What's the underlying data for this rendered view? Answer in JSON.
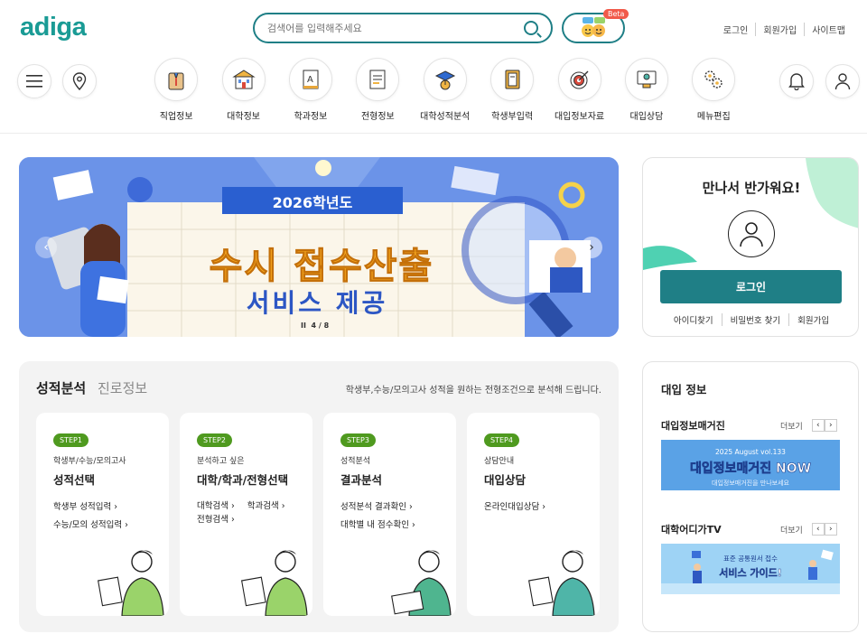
{
  "header": {
    "logo": "adiga",
    "search_placeholder": "검색어를 입력해주세요",
    "beta": "Beta",
    "links": [
      "로그인",
      "회원가입",
      "사이트맵"
    ]
  },
  "nav": [
    {
      "label": "직업정보",
      "icon": "job-icon"
    },
    {
      "label": "대학정보",
      "icon": "university-icon"
    },
    {
      "label": "학과정보",
      "icon": "book-icon"
    },
    {
      "label": "전형정보",
      "icon": "document-icon"
    },
    {
      "label": "대학성적분석",
      "icon": "graduation-chart-icon"
    },
    {
      "label": "학생부입력",
      "icon": "notebook-icon"
    },
    {
      "label": "대입정보자료",
      "icon": "target-icon"
    },
    {
      "label": "대입상담",
      "icon": "monitor-counsel-icon"
    },
    {
      "label": "메뉴편집",
      "icon": "gears-icon"
    }
  ],
  "banner": {
    "year": "2026학년도",
    "headline": "수시 접수산출",
    "sub": "서비스 제공",
    "pager": "4 / 8",
    "pause": "II"
  },
  "login": {
    "greeting": "만나서 반가워요!",
    "button": "로그인",
    "links": [
      "아이디찾기",
      "비밀번호 찾기",
      "회원가입"
    ]
  },
  "grade": {
    "tab_active": "성적분석",
    "tab_inactive": "진로정보",
    "desc": "학생부,수능/모의고사 성적을 원하는 전형조건으로 분석해 드립니다.",
    "cards": [
      {
        "step": "STEP1",
        "sub": "학생부/수능/모의고사",
        "title": "성적선택",
        "links": [
          "학생부 성적입력 ›",
          "수능/모의 성적입력 ›"
        ]
      },
      {
        "step": "STEP2",
        "sub": "분석하고 싶은",
        "title": "대학/학과/전형선택",
        "links": [
          "대학검색 ›",
          "학과검색 ›",
          "전형검색 ›"
        ]
      },
      {
        "step": "STEP3",
        "sub": "성적분석",
        "title": "결과분석",
        "links": [
          "성적분석 결과확인 ›",
          "대학별 내 점수확인 ›"
        ]
      },
      {
        "step": "STEP4",
        "sub": "상담안내",
        "title": "대입상담",
        "links": [
          "온라인대입상담 ›"
        ]
      }
    ]
  },
  "info": {
    "title": "대입 정보",
    "magazine": {
      "title": "대입정보매거진",
      "more": "더보기",
      "banner_top": "2025 August vol.133",
      "banner_main": "대입정보매거진 NOW",
      "banner_sub": "대입정보매거진을 만나보세요"
    },
    "tv": {
      "title": "대학어디가TV",
      "more": "더보기",
      "banner_top": "표준 공통원서 접수",
      "banner_main": "서비스 가이드!"
    }
  },
  "colors": {
    "brand": "#1a9b95",
    "login_button": "#1f7f86",
    "step": "#4f9a1f"
  }
}
